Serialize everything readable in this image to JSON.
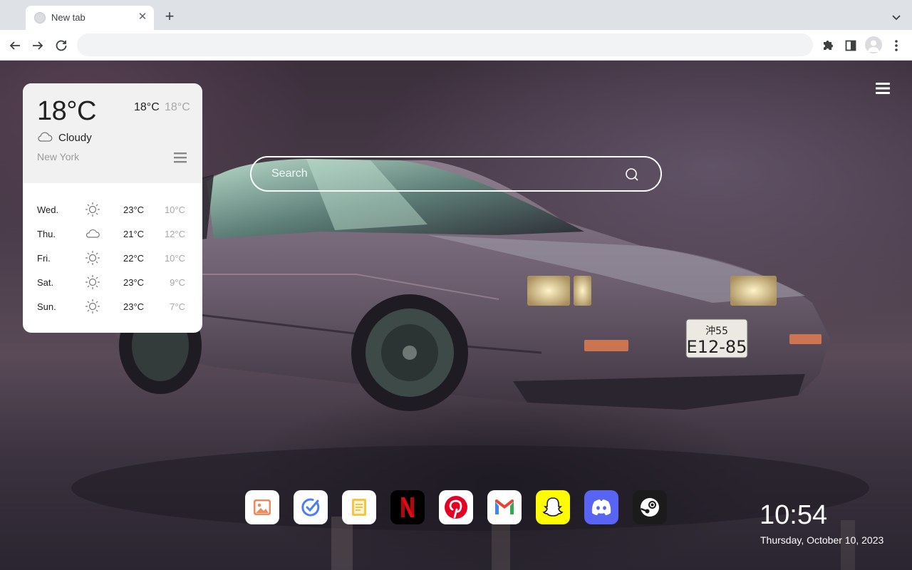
{
  "browser": {
    "tab_title": "New tab",
    "tab_close": "✕",
    "new_tab": "+",
    "address_placeholder": ""
  },
  "weather": {
    "current_temp": "18°C",
    "high": "18°C",
    "low": "18°C",
    "condition": "Cloudy",
    "condition_icon": "cloud-icon",
    "location": "New York",
    "forecast": [
      {
        "day": "Wed.",
        "icon": "sun-icon",
        "high": "23°C",
        "low": "10°C"
      },
      {
        "day": "Thu.",
        "icon": "cloud-icon",
        "high": "21°C",
        "low": "12°C"
      },
      {
        "day": "Fri.",
        "icon": "sun-icon",
        "high": "22°C",
        "low": "10°C"
      },
      {
        "day": "Sat.",
        "icon": "sun-icon",
        "high": "23°C",
        "low": "9°C"
      },
      {
        "day": "Sun.",
        "icon": "sun-icon",
        "high": "23°C",
        "low": "7°C"
      }
    ]
  },
  "search": {
    "placeholder": "Search"
  },
  "dock": {
    "apps": [
      {
        "name": "photos",
        "icon": "photos-icon",
        "color": "#ffffff"
      },
      {
        "name": "tasks",
        "icon": "check-icon",
        "color": "#ffffff"
      },
      {
        "name": "notes",
        "icon": "notes-icon",
        "color": "#ffffff"
      },
      {
        "name": "netflix",
        "icon": "netflix-icon",
        "color": "#000000"
      },
      {
        "name": "pinterest",
        "icon": "pinterest-icon",
        "color": "#ffffff"
      },
      {
        "name": "gmail",
        "icon": "gmail-icon",
        "color": "#ffffff"
      },
      {
        "name": "snapchat",
        "icon": "snapchat-icon",
        "color": "#fffc00"
      },
      {
        "name": "discord",
        "icon": "discord-icon",
        "color": "#5865f2"
      },
      {
        "name": "steam",
        "icon": "steam-icon",
        "color": "#1b1b1b"
      }
    ]
  },
  "clock": {
    "time": "10:54",
    "date": "Thursday, October 10, 2023"
  },
  "colors": {
    "accent_blue": "#4d7df2",
    "netflix_red": "#e50914",
    "pinterest_red": "#e60023",
    "snapchat_yellow": "#fffc00",
    "discord_blue": "#5865f2"
  }
}
